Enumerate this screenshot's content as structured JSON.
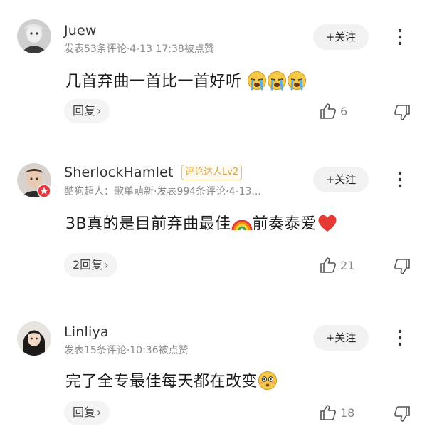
{
  "comments": [
    {
      "username": "Juew",
      "meta": "发表53条评论·4-13 17:38被点赞",
      "badge": "",
      "follow_label": "+关注",
      "text": "几首弃曲一首比一首好听",
      "emojis": [
        "cry-emoji",
        "cry-emoji",
        "cry-emoji"
      ],
      "reply_label": "回复",
      "like_count": "6"
    },
    {
      "username": "SherlockHamlet",
      "meta": "酷狗超人：歌单萌新·发表994条评论·4-13...",
      "badge": "评论达人Lv2",
      "follow_label": "+关注",
      "text_part1": "3B真的是目前弃曲最佳",
      "text_part2": "前奏泰爱",
      "emojis": [
        "rainbow-emoji",
        "red-heart-emoji"
      ],
      "reply_label": "2回复",
      "like_count": "21"
    },
    {
      "username": "Linliya",
      "meta": "发表15条评论·10:36被点赞",
      "badge": "",
      "follow_label": "+关注",
      "text": "完了全专最佳每天都在改变",
      "emojis": [
        "flushed-emoji"
      ],
      "reply_label": "回复",
      "like_count": "18"
    }
  ],
  "colors": {
    "meta_gray": "#8a8a8a",
    "badge_gold": "#d9a441",
    "pill_bg": "#f4f4f4"
  },
  "icons": [
    "more-vertical-icon",
    "thumbs-up-icon",
    "thumbs-down-icon",
    "chevron-right-icon"
  ]
}
